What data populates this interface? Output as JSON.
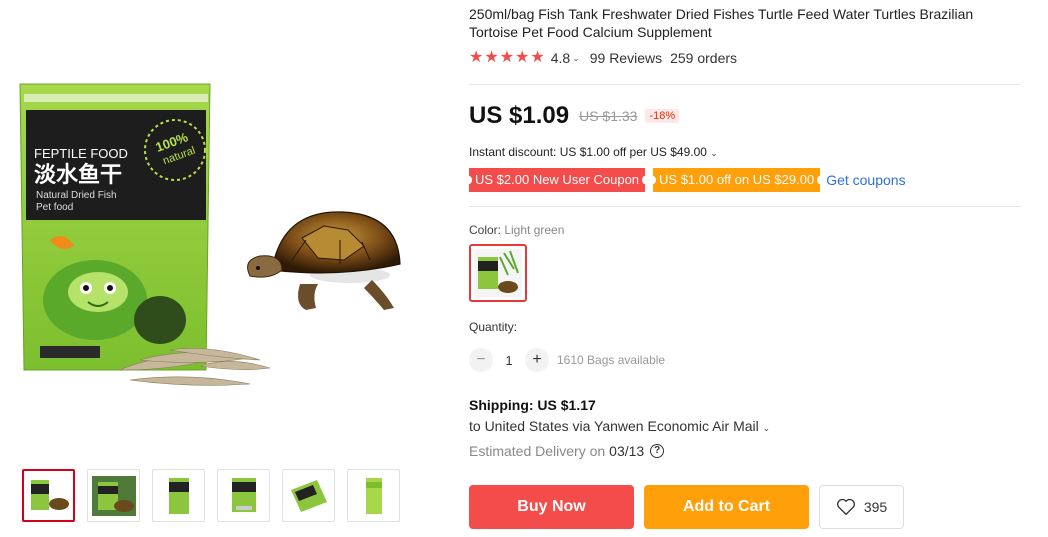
{
  "product": {
    "title": "250ml/bag Fish Tank Freshwater Dried Fishes Turtle Feed Water Turtles Brazilian Tortoise Pet Food Calcium Supplement",
    "rating": "4.8",
    "stars": 5,
    "reviews": "99 Reviews",
    "orders": "259 orders"
  },
  "gallery": {
    "package_text": {
      "brand": "FEPTILE FOOD",
      "chinese_name": "淡水鱼干",
      "subtitle_line1": "Natural Dried Fish",
      "subtitle_line2": "Pet food",
      "badge_pct": "100%",
      "badge_word": "natural"
    },
    "thumbnail_count": 6,
    "active_thumbnail": 0
  },
  "pricing": {
    "price": "US $1.09",
    "original_price": "US $1.33",
    "discount": "-18%",
    "instant_discount": "Instant discount: US $1.00 off per US $49.00"
  },
  "coupons": {
    "new_user": "US $2.00 New User Coupon",
    "store": "US $1.00 off on US $29.00",
    "link": "Get coupons"
  },
  "variant": {
    "label": "Color: ",
    "value": "Light green"
  },
  "quantity": {
    "label": "Quantity:",
    "value": "1",
    "minus": "−",
    "plus": "+",
    "available": "1610 Bags available"
  },
  "shipping": {
    "title": "Shipping: US $1.17",
    "route": "to United States via Yanwen Economic Air Mail",
    "delivery_label": "Estimated Delivery on",
    "delivery_date": "03/13"
  },
  "actions": {
    "buy_now": "Buy Now",
    "add_to_cart": "Add to Cart",
    "wishlist_count": "395"
  },
  "colors": {
    "star": "#f44b4b",
    "buy_now": "#f44b4b",
    "add_to_cart": "#ff9f0a",
    "coupon_red": "#f44b4b",
    "coupon_orange": "#ff9f0a",
    "link": "#2e6fd8",
    "package_green": "#8cc63f"
  },
  "icons": {
    "star": "star-icon",
    "caret": "chevron-down-icon",
    "help": "question-circle-icon",
    "wishlist": "heart-icon"
  }
}
